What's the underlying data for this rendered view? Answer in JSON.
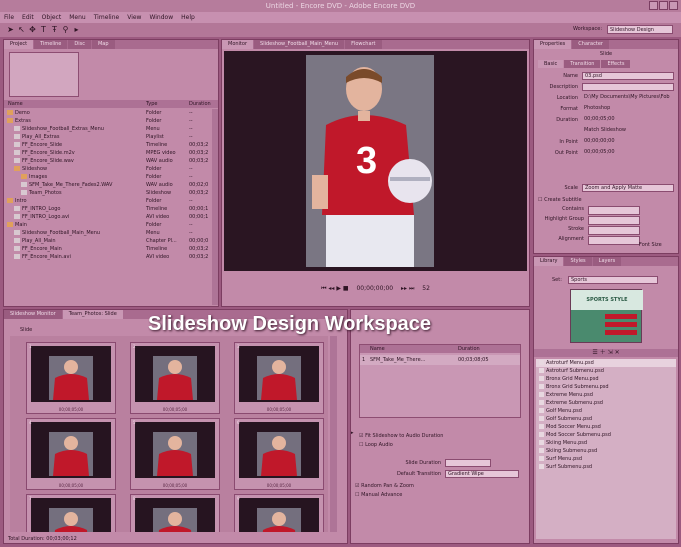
{
  "window": {
    "title": "Untitled - Encore DVD - Adobe Encore DVD"
  },
  "menu": [
    "File",
    "Edit",
    "Object",
    "Menu",
    "Timeline",
    "View",
    "Window",
    "Help"
  ],
  "workspace": {
    "label": "Workspace:",
    "value": "Slideshow Design"
  },
  "project_panel": {
    "tabs": [
      "Project",
      "Timeline",
      "Disc",
      "Map"
    ],
    "columns": [
      "Name",
      "Type",
      "Duration"
    ],
    "rows": [
      {
        "name": "Demo",
        "type": "Folder",
        "dur": "--"
      },
      {
        "name": "Extras",
        "type": "Folder",
        "dur": "--"
      },
      {
        "name": "Slideshow_Football_Extras_Menu",
        "type": "Menu",
        "dur": "--"
      },
      {
        "name": "Play_All_Extras",
        "type": "Playlist",
        "dur": "--"
      },
      {
        "name": "FF_Encore_Slide",
        "type": "Timeline",
        "dur": "00;03;2"
      },
      {
        "name": "FF_Encore_Slide.m2v",
        "type": "MPEG video",
        "dur": "00;03;2"
      },
      {
        "name": "FF_Encore_Slide.wav",
        "type": "WAV audio",
        "dur": "00;03;2"
      },
      {
        "name": "Slideshow",
        "type": "Folder",
        "dur": "--"
      },
      {
        "name": "Images",
        "type": "Folder",
        "dur": "--"
      },
      {
        "name": "SFM_Take_Me_There_Fades2.WAV",
        "type": "WAV audio",
        "dur": "00;02;0"
      },
      {
        "name": "Team_Photos",
        "type": "Slideshow",
        "dur": "00;03;2"
      },
      {
        "name": "Intro",
        "type": "Folder",
        "dur": "--"
      },
      {
        "name": "FF_INTRO_Logo",
        "type": "Timeline",
        "dur": "00;00;1"
      },
      {
        "name": "FF_INTRO_Logo.avi",
        "type": "AVI video",
        "dur": "00;00;1"
      },
      {
        "name": "Main",
        "type": "Folder",
        "dur": "--"
      },
      {
        "name": "Slideshow_Football_Main_Menu",
        "type": "Menu",
        "dur": "--"
      },
      {
        "name": "Play_All_Main",
        "type": "Chapter Pl...",
        "dur": "00;00;0"
      },
      {
        "name": "FF_Encore_Main",
        "type": "Timeline",
        "dur": "00;03;2"
      },
      {
        "name": "FF_Encore_Main.avi",
        "type": "AVI video",
        "dur": "00;03;2"
      }
    ]
  },
  "monitor": {
    "tabs": [
      "Monitor",
      "Slideshow_Football_Main_Menu",
      "Flowchart"
    ],
    "jersey_number": "3",
    "timecode": "00;00;00;00",
    "zoom": "52"
  },
  "properties": {
    "tabs": [
      "Properties",
      "Character"
    ],
    "heading": "Slide",
    "subtabs": [
      "Basic",
      "Transition",
      "Effects"
    ],
    "fields": [
      {
        "label": "Name",
        "value": "03.psd"
      },
      {
        "label": "Description",
        "value": ""
      },
      {
        "label": "Location",
        "value": "D:\\My Documents\\My Pictures\\Fob"
      },
      {
        "label": "Format",
        "value": "Photoshop"
      },
      {
        "label": "Duration",
        "value": "00;00;05;00"
      },
      {
        "label": "",
        "value": "Match Slideshow"
      },
      {
        "label": "In Point",
        "value": "00;00;00;00"
      },
      {
        "label": "Out Point",
        "value": "00;00;05;00"
      }
    ],
    "scale": {
      "label": "Scale",
      "value": "Zoom and Apply Matte"
    },
    "create_subtitle": "Create Subtitle",
    "sub_fields": [
      "Contains",
      "Highlight Group",
      "Stroke",
      "Alignment"
    ],
    "font_size": "Font Size"
  },
  "slideshow_panel": {
    "tabs": [
      "Slideshow Monitor",
      "Team_Photos: Slide"
    ],
    "slides_label": "Slide",
    "thumbs": [
      {
        "num": "1",
        "time": "00;00;05;00"
      },
      {
        "num": "2",
        "time": "00;00;05;00"
      },
      {
        "num": "3",
        "time": "00;00;05;00"
      },
      {
        "num": "4",
        "time": "00;00;05;00"
      },
      {
        "num": "5",
        "time": "00;00;05;00"
      },
      {
        "num": "6",
        "time": "00;00;05;00"
      },
      {
        "num": "7",
        "time": ""
      },
      {
        "num": "8",
        "time": ""
      },
      {
        "num": "9",
        "time": ""
      }
    ],
    "total_duration": "Total Duration: 00;03;00;12"
  },
  "audio_panel": {
    "columns": [
      "Name",
      "Duration"
    ],
    "row": {
      "num": "1",
      "name": "SFM_Take_Me_There...",
      "dur": "00;03;08;05"
    },
    "options": [
      {
        "label": "Fit Slideshow to Audio Duration",
        "checked": true
      },
      {
        "label": "Loop Audio",
        "checked": false
      }
    ],
    "slide_duration": "Slide Duration",
    "default_transition": {
      "label": "Default Transition",
      "value": "Gradient Wipe"
    },
    "pan_zoom": [
      {
        "label": "Random Pan & Zoom",
        "checked": true
      },
      {
        "label": "Manual Advance",
        "checked": false
      }
    ]
  },
  "library": {
    "tabs": [
      "Library",
      "Styles",
      "Layers"
    ],
    "set_label": "Set:",
    "set_value": "Sports",
    "preview_title": "SPORTS STYLE",
    "items": [
      "Astroturf Menu.psd",
      "Astroturf Submenu.psd",
      "Bronx Grid Menu.psd",
      "Bronx Grid Submenu.psd",
      "Extreme Menu.psd",
      "Extreme Submenu.psd",
      "Golf Menu.psd",
      "Golf Submenu.psd",
      "Mod Soccer Menu.psd",
      "Mod Soccer Submenu.psd",
      "Skiing Menu.psd",
      "Skiing Submenu.psd",
      "Surf Menu.psd",
      "Surf Submenu.psd"
    ]
  },
  "overlay_caption": "Slideshow Design Workspace",
  "colors": {
    "tint": "#9c5a80",
    "panel": "#c28aa9",
    "dark": "#261420",
    "jersey": "#c0182a"
  }
}
